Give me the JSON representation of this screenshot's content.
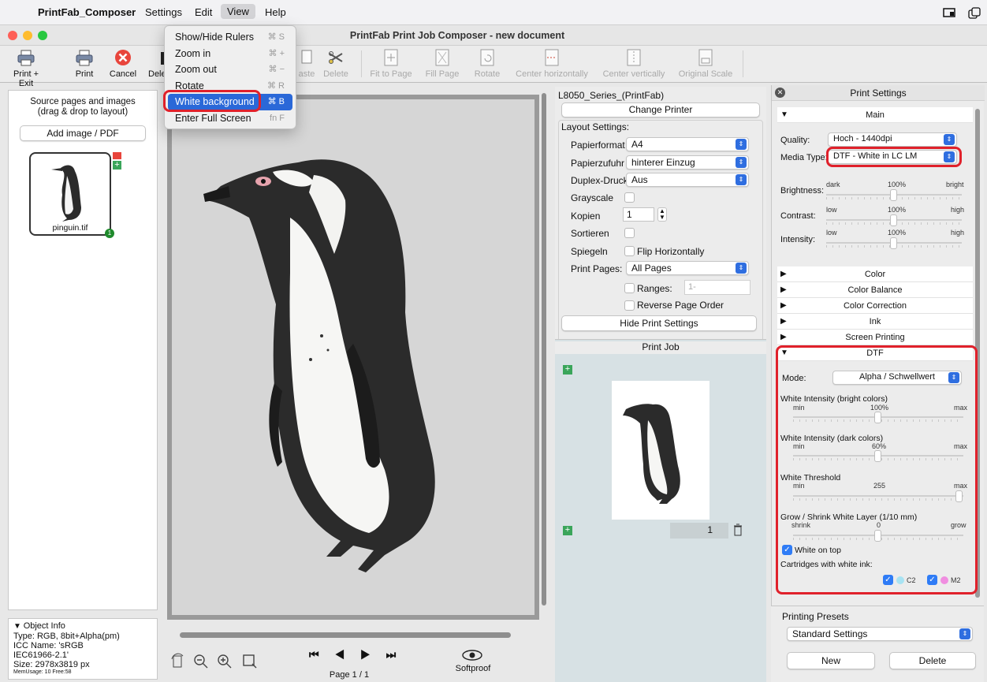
{
  "menubar": {
    "app": "PrintFab_Composer",
    "items": [
      "Settings",
      "Edit",
      "View",
      "Help"
    ]
  },
  "window": {
    "title": "PrintFab Print Job Composer - new document"
  },
  "toolbar": {
    "print_exit": "Print + Exit",
    "print": "Print",
    "cancel": "Cancel",
    "delete_partial": "Dele",
    "paste_partial": "aste",
    "delete": "Delete",
    "fit_to_page": "Fit to Page",
    "fill_page": "Fill Page",
    "rotate": "Rotate",
    "center_h": "Center horizontally",
    "center_v": "Center vertically",
    "original_scale": "Original Scale"
  },
  "view_menu": {
    "items": [
      {
        "label": "Show/Hide Rulers",
        "shortcut": "⌘ S"
      },
      {
        "label": "Zoom in",
        "shortcut": "⌘ +"
      },
      {
        "label": "Zoom out",
        "shortcut": "⌘ −"
      },
      {
        "label": "Rotate",
        "shortcut": "⌘ R"
      },
      {
        "label": "White background",
        "shortcut": "⌘ B"
      },
      {
        "label": "Enter Full Screen",
        "shortcut": "fn F"
      }
    ]
  },
  "left": {
    "source_title": "Source pages and images",
    "source_subtitle": "(drag & drop to layout)",
    "add_button": "Add image / PDF",
    "thumb_label": "pinguin.tif",
    "badge": "1"
  },
  "object_info": {
    "title": "Object Info",
    "type": "Type: RGB, 8bit+Alpha(pm)",
    "icc": "ICC Name: 'sRGB",
    "icc2": "IEC61966-2.1'",
    "size": "Size: 2978x3819 px",
    "mem": "MemUsage: 10 Free:58"
  },
  "navigation": {
    "page_label": "Page 1 / 1",
    "softproof": "Softproof"
  },
  "printer": {
    "name": "L8050_Series_(PrintFab)",
    "change_button": "Change Printer",
    "layout_heading": "Layout Settings:",
    "fields": {
      "papierformat_label": "Papierformat",
      "papierformat_value": "A4",
      "papierzufuhr_label": "Papierzufuhr",
      "papierzufuhr_value": "hinterer Einzug",
      "duplex_label": "Duplex-Druck",
      "duplex_value": "Aus",
      "grayscale_label": "Grayscale",
      "kopien_label": "Kopien",
      "kopien_value": "1",
      "sortieren_label": "Sortieren",
      "spiegeln_label": "Spiegeln",
      "flip_label": "Flip Horizontally",
      "print_pages_label": "Print Pages:",
      "print_pages_value": "All Pages",
      "ranges_label": "Ranges:",
      "ranges_placeholder": "1-",
      "reverse_label": "Reverse Page Order"
    },
    "hide_button": "Hide Print Settings"
  },
  "print_job": {
    "title": "Print Job",
    "copies": "1"
  },
  "print_settings": {
    "title": "Print Settings",
    "main": "Main",
    "quality_label": "Quality:",
    "quality_value": "Hoch - 1440dpi",
    "media_label": "Media Type:",
    "media_value": "DTF - White in LC LM",
    "brightness": {
      "label": "Brightness:",
      "min": "dark",
      "mid": "100%",
      "max": "bright",
      "level": 0.5
    },
    "contrast": {
      "label": "Contrast:",
      "min": "low",
      "mid": "100%",
      "max": "high",
      "level": 0.5
    },
    "intensity": {
      "label": "Intensity:",
      "min": "low",
      "mid": "100%",
      "max": "high",
      "level": 0.5
    },
    "sections": [
      "Color",
      "Color Balance",
      "Color Correction",
      "Ink",
      "Screen Printing"
    ],
    "dtf": {
      "title": "DTF",
      "mode_label": "Mode:",
      "mode_value": "Alpha / Schwellwert",
      "white_bright": {
        "label": "White Intensity (bright colors)",
        "min": "min",
        "mid": "100%",
        "max": "max",
        "level": 0.5
      },
      "white_dark": {
        "label": "White Intensity (dark colors)",
        "min": "min",
        "mid": "60%",
        "max": "max",
        "level": 0.5
      },
      "threshold": {
        "label": "White Threshold",
        "min": "min",
        "mid": "255",
        "max": "max",
        "level": 1.0
      },
      "grow": {
        "label": "Grow / Shrink White Layer (1/10 mm)",
        "min": "shrink",
        "mid": "0",
        "max": "grow",
        "level": 0.5
      },
      "white_on_top": "White on top",
      "cartridges_label": "Cartridges with white ink:",
      "c2": "C2",
      "m2": "M2",
      "c2_color": "#a8e3f3",
      "m2_color": "#f08ee0"
    }
  },
  "presets": {
    "title": "Printing Presets",
    "value": "Standard Settings",
    "new": "New",
    "delete": "Delete"
  },
  "colors": {
    "accent": "#2a68d8",
    "highlight": "#e0212b"
  }
}
